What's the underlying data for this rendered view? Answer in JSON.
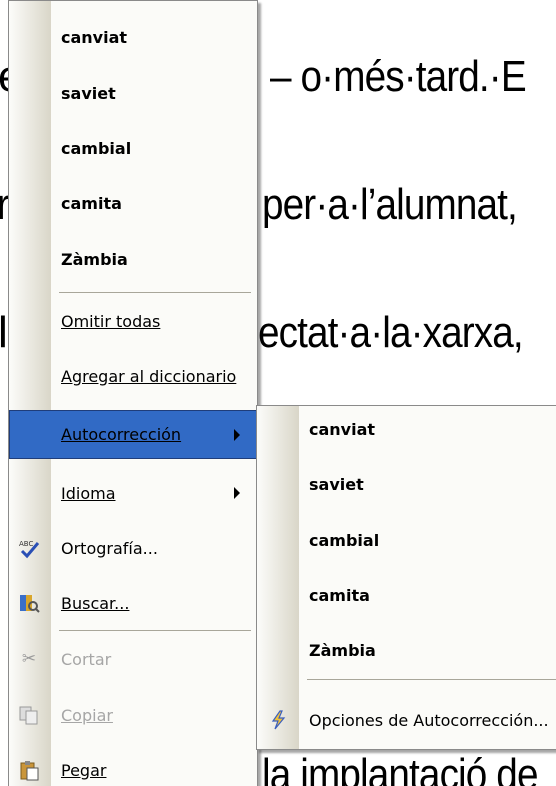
{
  "document": {
    "line1_end": "– o·més·tard.·E",
    "line2_end": "per·a·l’alumnat,",
    "line3_end": "ectat·a·la·xarxa,",
    "line4_end": "la implantació de",
    "frag_e": "e",
    "frag_r": "r",
    "frag_l": "l"
  },
  "context_menu": {
    "suggestions": [
      "canviat",
      "saviet",
      "cambial",
      "camita",
      "Zàmbia"
    ],
    "items": [
      {
        "label": "Omitir todas",
        "accel": "O"
      },
      {
        "label": "Agregar al diccionario",
        "accel": "A"
      },
      {
        "label": "Autocorrección",
        "accel": "A",
        "submenu": true,
        "selected": true
      },
      {
        "label": "Idioma",
        "accel": "I",
        "submenu": true
      },
      {
        "label": "Ortografía...",
        "icon": "spelling-abc-check-icon"
      },
      {
        "label": "Buscar...",
        "accel": "B",
        "icon": "research-books-icon"
      },
      {
        "label": "Cortar",
        "accel": "t",
        "icon": "scissors-icon",
        "disabled": true
      },
      {
        "label": "Copiar",
        "accel": "C",
        "icon": "copy-pages-icon",
        "disabled": true
      },
      {
        "label": "Pegar",
        "accel": "P",
        "icon": "clipboard-paste-icon"
      }
    ]
  },
  "autocorrect_submenu": {
    "suggestions": [
      "canviat",
      "saviet",
      "cambial",
      "camita",
      "Zàmbia"
    ],
    "options_label": "Opciones de Autocorrección...",
    "options_icon": "lightning-autocorrect-icon"
  },
  "colors": {
    "selection": "#316ac5",
    "gutter_start": "#fcfcfa",
    "gutter_end": "#d9d6c8",
    "menu_bg": "#fbfbf8"
  }
}
